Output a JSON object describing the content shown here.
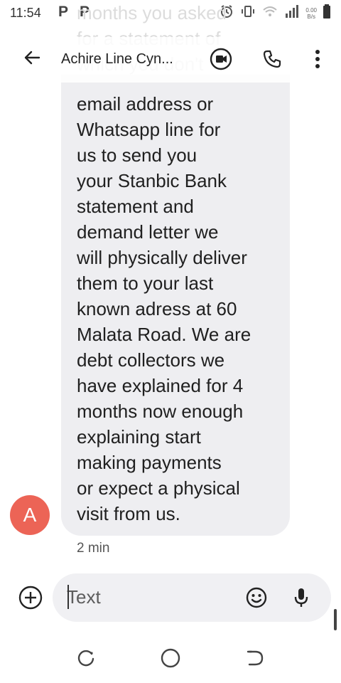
{
  "status_bar": {
    "time": "11:54",
    "app_icon_1": "P",
    "app_icon_2": "P",
    "net_speed_value": "0.00",
    "net_speed_unit": "B/s",
    "icons": [
      "alarm-icon",
      "vibrate-icon",
      "wifi-icon",
      "signal-icon",
      "battery-icon"
    ]
  },
  "scrolled_text": "months  you asked\nfor a statement of\nwhich you don't\nwant to share your",
  "app_bar": {
    "contact_name": "Achire Line Cyn...",
    "icons": [
      "back-arrow-icon",
      "video-call-icon",
      "phone-icon",
      "more-vert-icon"
    ]
  },
  "conversation": {
    "message": "email address or\nWhatsapp line for\nus to send you\nyour Stanbic Bank\nstatement and\ndemand letter we\nwill physically deliver\nthem to your last\nknown adress at 60\nMalata Road. We are\ndebt collectors   we\nhave explained for 4\nmonths now enough\nexplaining start\nmaking payments\nor expect a physical\nvisit from us.",
    "avatar_letter": "A",
    "timestamp": "2 min"
  },
  "compose": {
    "placeholder": "Text",
    "icons": [
      "add-circle-icon",
      "emoji-icon",
      "microphone-icon"
    ]
  },
  "nav_bar": {
    "icons": [
      "recent-apps-icon",
      "home-icon",
      "back-icon"
    ]
  },
  "colors": {
    "avatar": "#ec6456",
    "bubble": "#eeeef1",
    "compose_box": "#f0f0f3",
    "faded_text": "#dcdcdc"
  }
}
